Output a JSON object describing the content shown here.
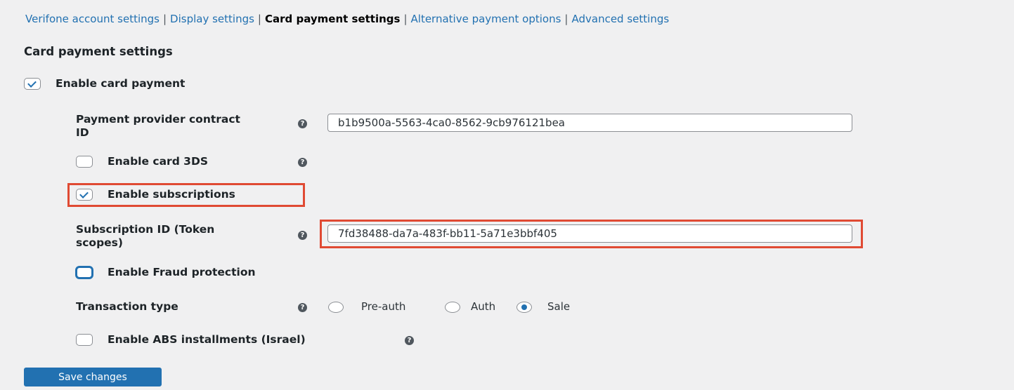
{
  "subnav": {
    "items": [
      {
        "label": "Verifone account settings",
        "current": false
      },
      {
        "label": "Display settings",
        "current": false
      },
      {
        "label": "Card payment settings",
        "current": true
      },
      {
        "label": "Alternative payment options",
        "current": false
      },
      {
        "label": "Advanced settings",
        "current": false
      }
    ],
    "separator": "|"
  },
  "section_title": "Card payment settings",
  "enable_card_payment": {
    "label": "Enable card payment",
    "checked": true
  },
  "contract_id": {
    "label": "Payment provider contract ID",
    "value": "b1b9500a-5563-4ca0-8562-9cb976121bea"
  },
  "enable_card_3ds": {
    "label": "Enable card 3DS",
    "checked": false
  },
  "enable_subscriptions": {
    "label": "Enable subscriptions",
    "checked": true
  },
  "subscription_id": {
    "label": "Subscription ID (Token scopes)",
    "value": "7fd38488-da7a-483f-bb11-5a71e3bbf405"
  },
  "enable_fraud_protection": {
    "label": "Enable Fraud protection",
    "checked": false
  },
  "transaction_type": {
    "label": "Transaction type",
    "options": [
      "Pre-auth",
      "Auth",
      "Sale"
    ],
    "selected": "Sale"
  },
  "enable_abs_installments": {
    "label": "Enable ABS installments (Israel)",
    "checked": false
  },
  "help_glyph": "?",
  "save_button": {
    "label": "Save changes"
  },
  "colors": {
    "accent": "#2271b1",
    "highlight": "#e04a33",
    "background": "#f0f0f1"
  }
}
